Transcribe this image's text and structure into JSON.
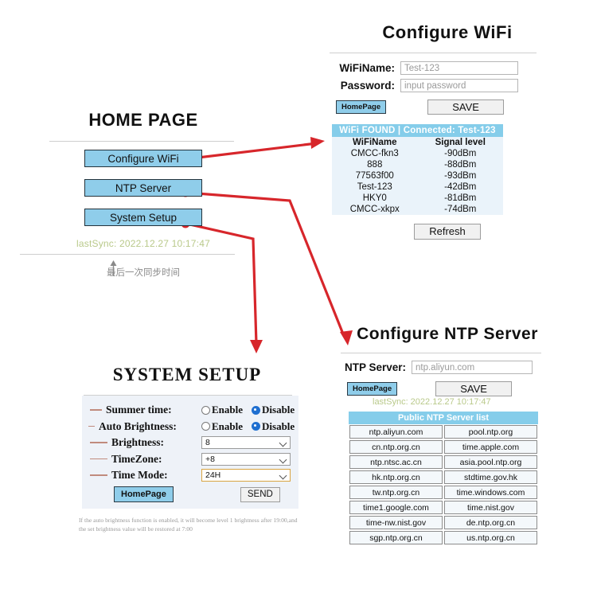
{
  "home": {
    "title": "HOME PAGE",
    "buttons": [
      {
        "label": "Configure WiFi"
      },
      {
        "label": "NTP Server"
      },
      {
        "label": "System Setup"
      }
    ],
    "last_sync": "lastSync: 2022.12.27 10:17:47",
    "annotation_cn": "最后一次同步时间",
    "button_color": "#8fcdea",
    "last_sync_color": "#b9c98a"
  },
  "wifi": {
    "title": "Configure WiFi",
    "fields": [
      {
        "label": "WiFiName:",
        "value": "Test-123",
        "placeholder": "Test-123"
      },
      {
        "label": "Password:",
        "value": "",
        "placeholder": "input password"
      }
    ],
    "homepage_label": "HomePage",
    "save_label": "SAVE",
    "table_header": "WiFi FOUND  |  Connected: Test-123",
    "columns": [
      "WiFiName",
      "Signal level"
    ],
    "rows": [
      {
        "name": "CMCC-fkn3",
        "signal": "-90dBm"
      },
      {
        "name": "888",
        "signal": "-88dBm"
      },
      {
        "name": "77563f00",
        "signal": "-93dBm"
      },
      {
        "name": "Test-123",
        "signal": "-42dBm"
      },
      {
        "name": "HKY0",
        "signal": "-81dBm"
      },
      {
        "name": "CMCC-xkpx",
        "signal": "-74dBm"
      }
    ],
    "refresh_label": "Refresh",
    "header_color": "#85cdea",
    "panel_color": "#eaf3fa"
  },
  "ntp": {
    "title": "Configure NTP Server",
    "field_label": "NTP Server:",
    "field_value": "ntp.aliyun.com",
    "field_placeholder": "ntp.aliyun.com",
    "homepage_label": "HomePage",
    "save_label": "SAVE",
    "last_sync": "lastSync: 2022.12.27 10:17:47",
    "list_header": "Public NTP Server list",
    "servers": [
      [
        "ntp.aliyun.com",
        "pool.ntp.org"
      ],
      [
        "cn.ntp.org.cn",
        "time.apple.com"
      ],
      [
        "ntp.ntsc.ac.cn",
        "asia.pool.ntp.org"
      ],
      [
        "hk.ntp.org.cn",
        "stdtime.gov.hk"
      ],
      [
        "tw.ntp.org.cn",
        "time.windows.com"
      ],
      [
        "time1.google.com",
        "time.nist.gov"
      ],
      [
        "time-nw.nist.gov",
        "de.ntp.org.cn"
      ],
      [
        "sgp.ntp.org.cn",
        "us.ntp.org.cn"
      ]
    ]
  },
  "system": {
    "title": "SYSTEM SETUP",
    "rows": [
      {
        "label": "Summer time:",
        "type": "radio",
        "options": [
          "Enable",
          "Disable"
        ],
        "selected": "Disable"
      },
      {
        "label": "Auto Brightness:",
        "type": "radio",
        "options": [
          "Enable",
          "Disable"
        ],
        "selected": "Disable"
      },
      {
        "label": "Brightness:",
        "type": "select",
        "value": "8"
      },
      {
        "label": "TimeZone:",
        "type": "select",
        "value": "+8"
      },
      {
        "label": "Time Mode:",
        "type": "select",
        "value": "24H"
      }
    ],
    "homepage_label": "HomePage",
    "send_label": "SEND",
    "footnote": "If the auto brightness function is enabled, it will become level 1 brightness after 19:00,and the set brightness value will be restored at 7:00",
    "radio_on_color": "#1f6fd0",
    "focus_border_color": "#d9a441"
  },
  "arrow_color": "#d7262b"
}
